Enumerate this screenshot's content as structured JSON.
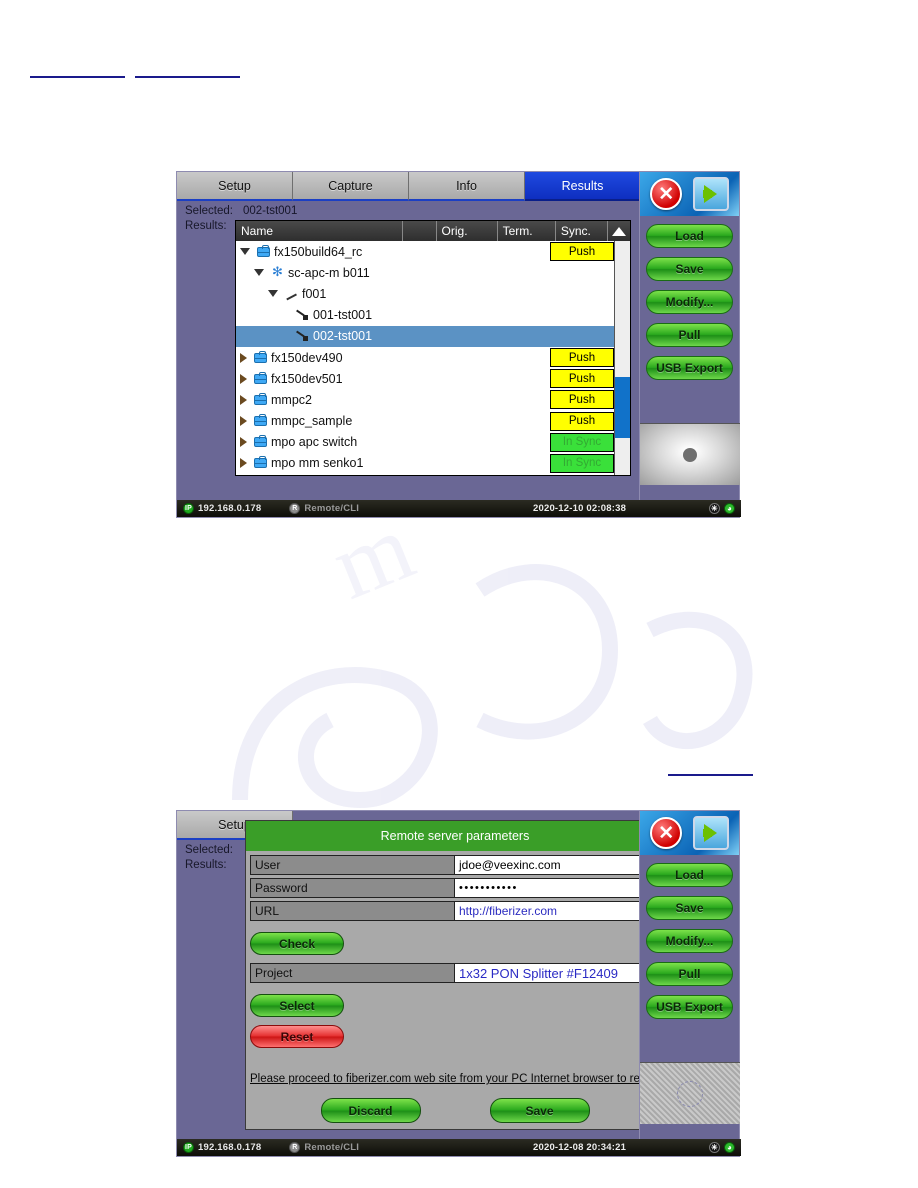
{
  "document": {
    "top_links": [
      "",
      ""
    ],
    "mid_link": "",
    "bullets": [
      "",
      "",
      ""
    ]
  },
  "screen1": {
    "tabs": [
      {
        "label": "Setup",
        "active": false
      },
      {
        "label": "Capture",
        "active": false
      },
      {
        "label": "Info",
        "active": false
      },
      {
        "label": "Results",
        "active": true
      }
    ],
    "selected_label": "Selected:",
    "selected_value": "002-tst001",
    "results_label": "Results:",
    "columns": [
      "Name",
      "",
      "Orig.",
      "Term.",
      "Sync."
    ],
    "scroll_up_icon": "triangle-up-icon",
    "scroll_down_icon": "triangle-down-icon",
    "rows": [
      {
        "name": "fx150build64_rc",
        "indent": 0,
        "icon": "case-icon",
        "expander": "open",
        "sync": "Push",
        "sync_state": "push",
        "selected": false
      },
      {
        "name": "sc-apc-m b011",
        "indent": 1,
        "icon": "snowflake-icon",
        "expander": "open",
        "sync": "",
        "sync_state": "none",
        "selected": false
      },
      {
        "name": "f001",
        "indent": 2,
        "icon": "fiber-icon",
        "expander": "open",
        "sync": "",
        "sync_state": "none",
        "selected": false
      },
      {
        "name": "001-tst001",
        "indent": 3,
        "icon": "connector-icon",
        "expander": "none",
        "sync": "",
        "sync_state": "none",
        "selected": false
      },
      {
        "name": "002-tst001",
        "indent": 3,
        "icon": "connector-icon",
        "expander": "none",
        "sync": "",
        "sync_state": "none",
        "selected": true
      },
      {
        "name": "fx150dev490",
        "indent": 0,
        "icon": "case-icon",
        "expander": "closed",
        "sync": "Push",
        "sync_state": "push",
        "selected": false
      },
      {
        "name": "fx150dev501",
        "indent": 0,
        "icon": "case-icon",
        "expander": "closed",
        "sync": "Push",
        "sync_state": "push",
        "selected": false
      },
      {
        "name": "mmpc2",
        "indent": 0,
        "icon": "case-icon",
        "expander": "closed",
        "sync": "Push",
        "sync_state": "push",
        "selected": false
      },
      {
        "name": "mmpc_sample",
        "indent": 0,
        "icon": "case-icon",
        "expander": "closed",
        "sync": "Push",
        "sync_state": "push",
        "selected": false
      },
      {
        "name": "mpo apc switch",
        "indent": 0,
        "icon": "case-icon",
        "expander": "closed",
        "sync": "In Sync",
        "sync_state": "insync",
        "selected": false
      },
      {
        "name": "mpo mm senko1",
        "indent": 0,
        "icon": "case-icon",
        "expander": "closed",
        "sync": "In Sync",
        "sync_state": "insync",
        "selected": false
      }
    ],
    "rail": {
      "close_icon": "close-icon",
      "next_icon": "next-arrow-icon",
      "buttons": [
        "Load",
        "Save",
        "Modify...",
        "Pull",
        "USB Export"
      ]
    },
    "status": {
      "ip_badge": "IP",
      "ip": "192.168.0.178",
      "remote_badge": "R",
      "remote": "Remote/CLI",
      "datetime": "2020-12-10 02:08:38",
      "bluetooth_icon": "bluetooth-icon",
      "signal_icon": "signal-icon"
    }
  },
  "screen2": {
    "tabs": [
      {
        "label": "Setup",
        "active": false
      }
    ],
    "selected_label": "Selected:",
    "results_label": "Results:",
    "dialog": {
      "title": "Remote server parameters",
      "fields": [
        {
          "label": "User",
          "value": "jdoe@veexinc.com",
          "style": "plain"
        },
        {
          "label": "Password",
          "value": "•••••••••••",
          "style": "pwd"
        },
        {
          "label": "URL",
          "value": "http://fiberizer.com",
          "style": "link"
        }
      ],
      "check_button": "Check",
      "project_label": "Project",
      "project_value": "1x32 PON Splitter #F12409",
      "select_button": "Select",
      "reset_button": "Reset",
      "note": "Please proceed to fiberizer.com web site from your PC Internet browser to register.",
      "discard_button": "Discard",
      "save_button": "Save"
    },
    "rail": {
      "close_icon": "close-icon",
      "next_icon": "next-arrow-icon",
      "buttons": [
        "Load",
        "Save",
        "Modify...",
        "Pull",
        "USB Export"
      ]
    },
    "status": {
      "ip_badge": "IP",
      "ip": "192.168.0.178",
      "remote_badge": "R",
      "remote": "Remote/CLI",
      "datetime": "2020-12-08 20:34:21",
      "bluetooth_icon": "bluetooth-icon",
      "signal_icon": "signal-icon"
    }
  }
}
